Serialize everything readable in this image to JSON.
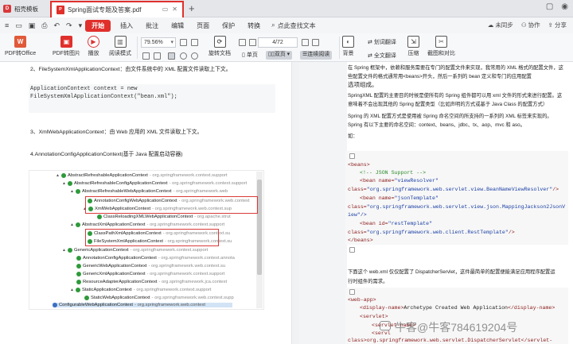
{
  "tabs": {
    "home": "稻壳模板",
    "doc_title": "Spring面试专题及答案.pdf",
    "add": "+"
  },
  "menu": {
    "file": "文件",
    "items": [
      "开始",
      "插入",
      "批注",
      "编辑",
      "页面",
      "保护",
      "转换"
    ],
    "search": "点此查找文本",
    "sync": "未同步",
    "collab": "协作",
    "share": "分享"
  },
  "toolbar": {
    "pdf_to_office": "PDF转Office",
    "pdf_to_image": "PDF转图片",
    "play": "播放",
    "read_mode": "阅读模式",
    "zoom": "79.56%",
    "page": "4/72",
    "rotate": "旋转文档",
    "single": "单页",
    "double": "双页",
    "continuous": "连续阅读",
    "background": "背景",
    "translate_select": "划词翻译",
    "translate_full": "全文翻译",
    "compress": "压缩",
    "screenshot": "截图和对比"
  },
  "left_page": {
    "item2": "2、FileSystemXmlApplicationContext：由文件系统中的 XML 配置文件读取上下文。",
    "code1": "ApplicationContext context = new",
    "code2": "FileSystemXmlApplicationContext(\"bean.xml\");",
    "item3": "3、XmlWebApplicationContext：由 Web 应用的 XML 文件读取上下文。",
    "item4": "4.AnnotationConfigApplicationContext(基于 Java 配置启动容器)"
  },
  "tree": [
    {
      "name": "AbstractRefreshableApplicationContext",
      "pkg": " - org.springframework.context.support"
    },
    {
      "name": "AbstractRefreshableConfigApplicationContext",
      "pkg": " - org.springframework.context.support"
    },
    {
      "name": "AbstractRefreshableWebApplicationContext",
      "pkg": " - org.springframework.web"
    },
    {
      "name": "AnnotationConfigWebApplicationContext",
      "pkg": " - org.springframework.web.context"
    },
    {
      "name": "XmlWebApplicationContext",
      "pkg": " - org.springframework.web.context.sup"
    },
    {
      "name": "ClassReloadingXMLWebApplicationContext",
      "pkg": " - org.apache.strut"
    },
    {
      "name": "AbstractXmlApplicationContext",
      "pkg": " - org.springframework.context.support"
    },
    {
      "name": "ClassPathXmlApplicationContext",
      "pkg": " - org.springframework.context.su"
    },
    {
      "name": "FileSystemXmlApplicationContext",
      "pkg": " - org.springframework.context.su"
    },
    {
      "name": "GenericApplicationContext",
      "pkg": " - org.springframework.context.support"
    },
    {
      "name": "AnnotationConfigApplicationContext",
      "pkg": " - org.springframework.context.annota"
    },
    {
      "name": "GenericWebApplicationContext",
      "pkg": " - org.springframework.web.context.su"
    },
    {
      "name": "GenericXmlApplicationContext",
      "pkg": " - org.springframework.context.support"
    },
    {
      "name": "ResourceAdapterApplicationContext",
      "pkg": " - org.springframework.jca.context"
    },
    {
      "name": "StaticApplicationContext",
      "pkg": " - org.springframework.context.support"
    },
    {
      "name": "StaticWebApplicationContext",
      "pkg": " - org.springframework.web.context.supp"
    },
    {
      "name": "ConfigurableWebApplicationContext",
      "pkg": " - org.springframework.web.context"
    }
  ],
  "right_page": {
    "p1": "在 Spring 框架中，依赖和服务需要在专门的配置文件来实现，我常用的 XML 格式的配置文件，这",
    "p2": "些配置文件的格式通常用<beans>开头，然后一系列的 bean 定义和专门的应用配置",
    "p3": "选项组成。",
    "p4": "SpringXML 配置的主要目的时候是使所有的 Spring 组件都可以用 xml 文件的形式来进行配置。这",
    "p5": "意味着不会出现其他的 Spring 配置类型（比如声明的方式或基于 Java Class 的配置方式）",
    "p6": "Spring 的 XML 配置方式是使用被 Spring 命名空间的所支持的一系列的 XML 标签来实现的。",
    "p7": "Spring 有以下主要的命名空间：context、beans、jdbc、tx、aop、mvc 和 aso。",
    "p8": "如：",
    "x1": "<beans>",
    "x2": "<!-- JSON Support -->",
    "x3a": "<bean name=",
    "x3b": "\"viewResolver\"",
    "x4a": "class=",
    "x4b": "\"org.springframework.web.servlet.view.BeanNameViewResolver\"",
    "x4c": "/>",
    "x5a": "<bean name=",
    "x5b": "\"jsonTemplate\"",
    "x6a": "class=",
    "x6b": "\"org.springframework.web.servlet.view.json.MappingJackson2JsonV",
    "x7": "iew\"/>",
    "x8a": "<bean id=",
    "x8b": "\"restTemplate\"",
    "x9a": "class=",
    "x9b": "\"org.springframework.web.client.RestTemplate\"",
    "x9c": "/>",
    "x10": "</beans>",
    "p9": "下面这个 web.xml 仅仅配置了 DispatcherServlet，这件最简单的配置便能满足应用程序配置运",
    "p10": "行时组件的需求。",
    "y1": "<web-app>",
    "y2a": "<display-name>",
    "y2b": "Archetype Created Web Application",
    "y2c": "</display-name>",
    "y3": "<servlet>",
    "y4": "<servlet-name>",
    "y5": "<servl",
    "y6": "class>org.springframework.web.servlet.DispatcherServlet</servlet-"
  },
  "watermark": "牛客@牛客784619204号"
}
